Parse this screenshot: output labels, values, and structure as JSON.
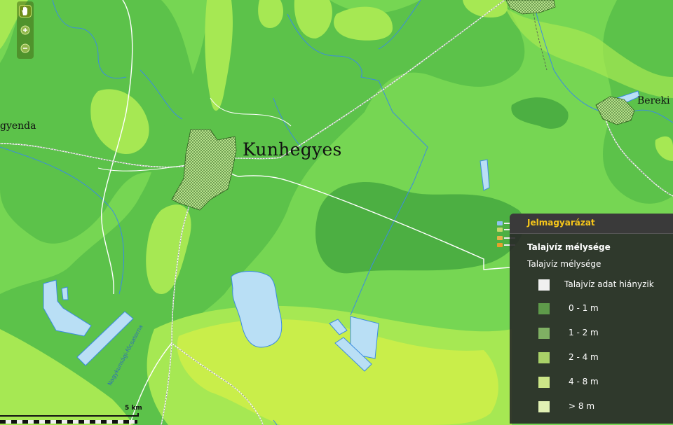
{
  "map": {
    "labels": {
      "city": "Kunhegyes",
      "village_right": "Bereki",
      "village_left": "gyenda",
      "canal": "Nagykunsági-főcsatorna"
    },
    "scale_text": "5 km",
    "colors": {
      "lightest": "#c9ee4a",
      "light": "#a6e853",
      "mid": "#76d653",
      "dark": "#5cc24a",
      "darker": "#4caf42",
      "water": "#b9dff5",
      "road": "#ffffff",
      "stream": "#3c8ce0",
      "settlement": "#a9db7a"
    }
  },
  "toolbar": {
    "tools": [
      {
        "icon": "hand-pan-icon",
        "active": true
      },
      {
        "icon": "zoom-in-icon",
        "active": false
      },
      {
        "icon": "zoom-out-icon",
        "active": false
      }
    ]
  },
  "legend": {
    "title": "Jelmagyarázat",
    "layer_title": "Talajvíz mélysége",
    "subtitle": "Talajvíz mélysége",
    "items": [
      {
        "label": "Talajvíz adat hiányzik",
        "color": "#f0f0f0"
      },
      {
        "label": "0 - 1 m",
        "color": "#5e9a4a"
      },
      {
        "label": "1 - 2 m",
        "color": "#7fb063"
      },
      {
        "label": "2 - 4 m",
        "color": "#a9d168"
      },
      {
        "label": "4 - 8 m",
        "color": "#cbe587"
      },
      {
        "label": "> 8 m",
        "color": "#e1f0b4"
      }
    ]
  }
}
